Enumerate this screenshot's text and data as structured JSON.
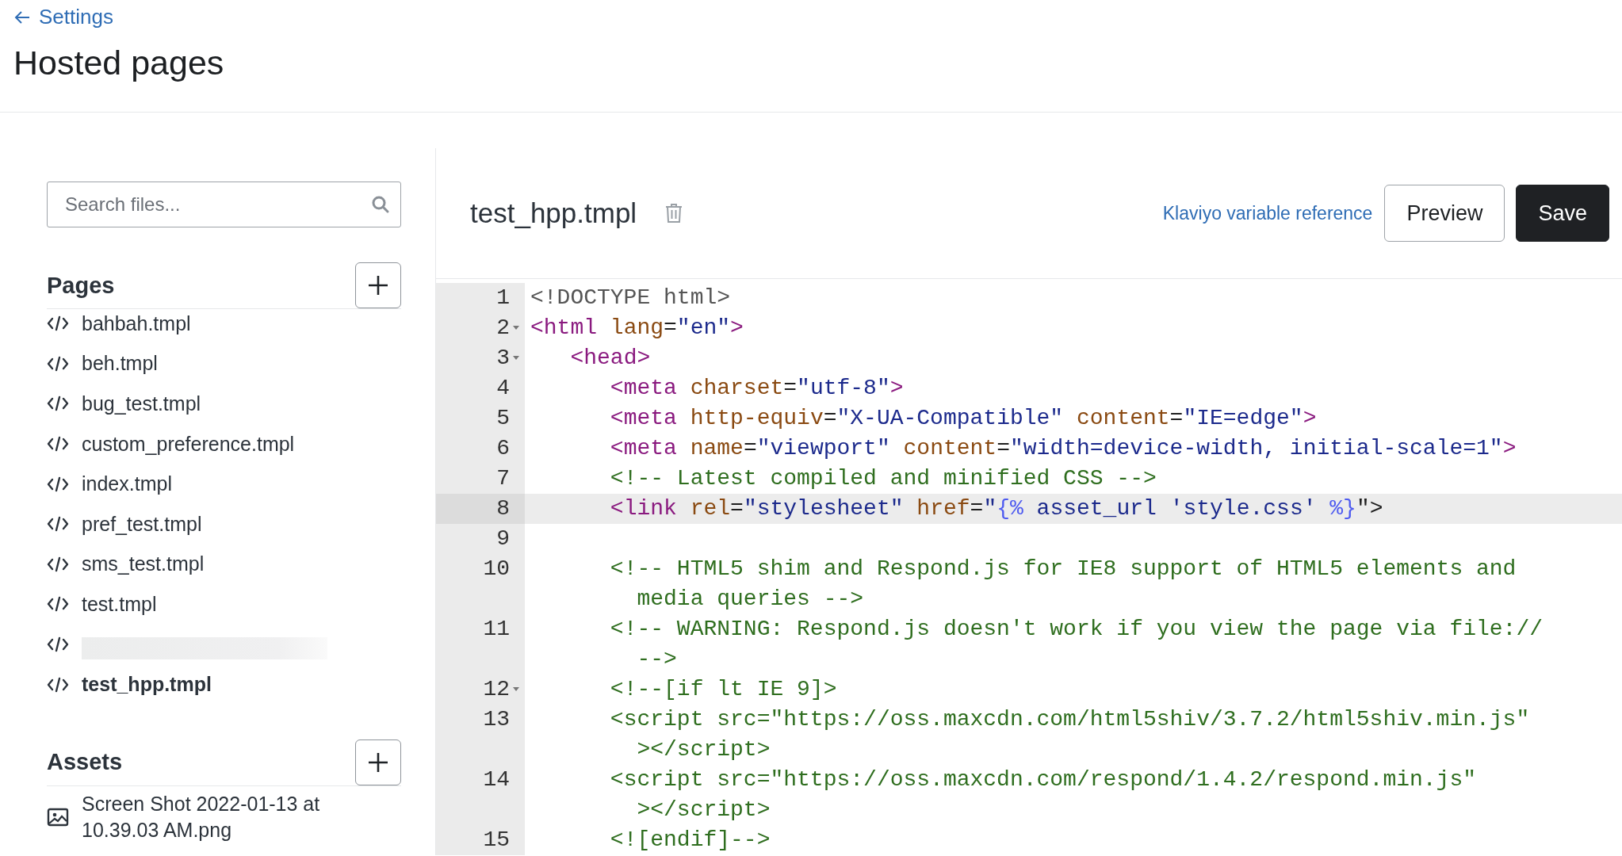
{
  "back_link": {
    "label": "Settings"
  },
  "title": "Hosted pages",
  "search": {
    "placeholder": "Search files..."
  },
  "pages": {
    "heading": "Pages",
    "items": [
      {
        "kind": "file",
        "name": "bahbah.tmpl",
        "selected": false
      },
      {
        "kind": "file",
        "name": "beh.tmpl",
        "selected": false
      },
      {
        "kind": "file",
        "name": "bug_test.tmpl",
        "selected": false
      },
      {
        "kind": "file",
        "name": "custom_preference.tmpl",
        "selected": false
      },
      {
        "kind": "file",
        "name": "index.tmpl",
        "selected": false
      },
      {
        "kind": "file",
        "name": "pref_test.tmpl",
        "selected": false
      },
      {
        "kind": "file",
        "name": "sms_test.tmpl",
        "selected": false
      },
      {
        "kind": "file",
        "name": "test.tmpl",
        "selected": false
      },
      {
        "kind": "redacted",
        "selected": false
      },
      {
        "kind": "file",
        "name": "test_hpp.tmpl",
        "selected": true
      }
    ]
  },
  "assets": {
    "heading": "Assets",
    "items": [
      {
        "kind": "image",
        "name": "Screen Shot 2022-01-13 at 10.39.03 AM.png"
      }
    ]
  },
  "editor": {
    "file_name": "test_hpp.tmpl",
    "reference_link": "Klaviyo variable reference",
    "buttons": [
      {
        "kind": "secondary",
        "label": "Preview"
      },
      {
        "kind": "primary",
        "label": "Save"
      }
    ],
    "lines": [
      {
        "number": "1",
        "foldable": false,
        "active": false,
        "rows": [
          [
            {
              "kind": "doctype",
              "text": "<!DOCTYPE html>"
            }
          ]
        ]
      },
      {
        "number": "2",
        "foldable": true,
        "active": false,
        "rows": [
          [
            {
              "kind": "tag",
              "text": "<html"
            },
            {
              "kind": "plain",
              "text": " "
            },
            {
              "kind": "attr",
              "text": "lang"
            },
            {
              "kind": "plain",
              "text": "="
            },
            {
              "kind": "string",
              "text": "\"en\""
            },
            {
              "kind": "tag",
              "text": ">"
            }
          ]
        ]
      },
      {
        "number": "3",
        "foldable": true,
        "active": false,
        "rows": [
          [
            {
              "kind": "plain",
              "text": "   "
            },
            {
              "kind": "tag",
              "text": "<head>"
            }
          ]
        ]
      },
      {
        "number": "4",
        "foldable": false,
        "active": false,
        "rows": [
          [
            {
              "kind": "plain",
              "text": "      "
            },
            {
              "kind": "tag",
              "text": "<meta"
            },
            {
              "kind": "plain",
              "text": " "
            },
            {
              "kind": "attr",
              "text": "charset"
            },
            {
              "kind": "plain",
              "text": "="
            },
            {
              "kind": "string",
              "text": "\"utf-8\""
            },
            {
              "kind": "tag",
              "text": ">"
            }
          ]
        ]
      },
      {
        "number": "5",
        "foldable": false,
        "active": false,
        "rows": [
          [
            {
              "kind": "plain",
              "text": "      "
            },
            {
              "kind": "tag",
              "text": "<meta"
            },
            {
              "kind": "plain",
              "text": " "
            },
            {
              "kind": "attr",
              "text": "http-equiv"
            },
            {
              "kind": "plain",
              "text": "="
            },
            {
              "kind": "string",
              "text": "\"X-UA-Compatible\""
            },
            {
              "kind": "plain",
              "text": " "
            },
            {
              "kind": "attr",
              "text": "content"
            },
            {
              "kind": "plain",
              "text": "="
            },
            {
              "kind": "string",
              "text": "\"IE=edge\""
            },
            {
              "kind": "tag",
              "text": ">"
            }
          ]
        ]
      },
      {
        "number": "6",
        "foldable": false,
        "active": false,
        "rows": [
          [
            {
              "kind": "plain",
              "text": "      "
            },
            {
              "kind": "tag",
              "text": "<meta"
            },
            {
              "kind": "plain",
              "text": " "
            },
            {
              "kind": "attr",
              "text": "name"
            },
            {
              "kind": "plain",
              "text": "="
            },
            {
              "kind": "string",
              "text": "\"viewport\""
            },
            {
              "kind": "plain",
              "text": " "
            },
            {
              "kind": "attr",
              "text": "content"
            },
            {
              "kind": "plain",
              "text": "="
            },
            {
              "kind": "string",
              "text": "\"width=device-width, initial-scale=1\""
            },
            {
              "kind": "tag",
              "text": ">"
            }
          ]
        ]
      },
      {
        "number": "7",
        "foldable": false,
        "active": false,
        "rows": [
          [
            {
              "kind": "plain",
              "text": "      "
            },
            {
              "kind": "comment",
              "text": "<!-- Latest compiled and minified CSS -->"
            }
          ]
        ]
      },
      {
        "number": "8",
        "foldable": false,
        "active": true,
        "rows": [
          [
            {
              "kind": "plain",
              "text": "      "
            },
            {
              "kind": "tag",
              "text": "<link"
            },
            {
              "kind": "plain",
              "text": " "
            },
            {
              "kind": "attr",
              "text": "rel"
            },
            {
              "kind": "plain",
              "text": "="
            },
            {
              "kind": "string",
              "text": "\"stylesheet\""
            },
            {
              "kind": "plain",
              "text": " "
            },
            {
              "kind": "attr",
              "text": "href"
            },
            {
              "kind": "plain",
              "text": "="
            },
            {
              "kind": "string",
              "text": "\""
            },
            {
              "kind": "template",
              "text": "{%"
            },
            {
              "kind": "plain",
              "text": " "
            },
            {
              "kind": "string",
              "text": "asset_url"
            },
            {
              "kind": "plain",
              "text": " "
            },
            {
              "kind": "string",
              "text": "'style.css'"
            },
            {
              "kind": "plain",
              "text": " "
            },
            {
              "kind": "template",
              "text": "%}"
            },
            {
              "kind": "plain",
              "text": "\">"
            }
          ]
        ]
      },
      {
        "number": "9",
        "foldable": false,
        "active": false,
        "rows": [
          []
        ]
      },
      {
        "number": "10",
        "foldable": false,
        "active": false,
        "rows": [
          [
            {
              "kind": "plain",
              "text": "      "
            },
            {
              "kind": "comment",
              "text": "<!-- HTML5 shim and Respond.js for IE8 support of HTML5 elements and"
            }
          ],
          [
            {
              "kind": "plain",
              "text": "        "
            },
            {
              "kind": "comment",
              "text": "media queries -->"
            }
          ]
        ]
      },
      {
        "number": "11",
        "foldable": false,
        "active": false,
        "rows": [
          [
            {
              "kind": "plain",
              "text": "      "
            },
            {
              "kind": "comment",
              "text": "<!-- WARNING: Respond.js doesn't work if you view the page via file://"
            }
          ],
          [
            {
              "kind": "plain",
              "text": "        "
            },
            {
              "kind": "comment",
              "text": "-->"
            }
          ]
        ]
      },
      {
        "number": "12",
        "foldable": true,
        "active": false,
        "rows": [
          [
            {
              "kind": "plain",
              "text": "      "
            },
            {
              "kind": "comment",
              "text": "<!--[if lt IE 9]>"
            }
          ]
        ]
      },
      {
        "number": "13",
        "foldable": false,
        "active": false,
        "rows": [
          [
            {
              "kind": "plain",
              "text": "      "
            },
            {
              "kind": "comment",
              "text": "<script src=\"https://oss.maxcdn.com/html5shiv/3.7.2/html5shiv.min.js\""
            }
          ],
          [
            {
              "kind": "plain",
              "text": "        "
            },
            {
              "kind": "comment",
              "text": "></script>"
            }
          ]
        ]
      },
      {
        "number": "14",
        "foldable": false,
        "active": false,
        "rows": [
          [
            {
              "kind": "plain",
              "text": "      "
            },
            {
              "kind": "comment",
              "text": "<script src=\"https://oss.maxcdn.com/respond/1.4.2/respond.min.js\""
            }
          ],
          [
            {
              "kind": "plain",
              "text": "        "
            },
            {
              "kind": "comment",
              "text": "></script>"
            }
          ]
        ]
      },
      {
        "number": "15",
        "foldable": false,
        "active": false,
        "rows": [
          [
            {
              "kind": "plain",
              "text": "      "
            },
            {
              "kind": "comment",
              "text": "<![endif]-->"
            }
          ]
        ]
      }
    ]
  }
}
